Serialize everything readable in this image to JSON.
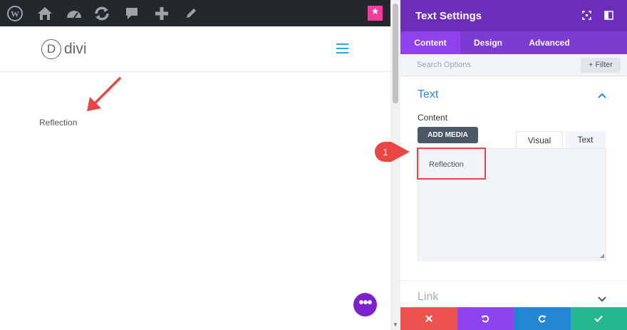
{
  "site": {
    "logo_letter": "D",
    "logo_text": "divi",
    "module_text": "Reflection"
  },
  "panel": {
    "title": "Text Settings",
    "tabs": [
      {
        "label": "Content",
        "active": true
      },
      {
        "label": "Design",
        "active": false
      },
      {
        "label": "Advanced",
        "active": false
      }
    ],
    "search_placeholder": "Search Options",
    "filter_label": "+ Filter",
    "section_title": "Text",
    "content_label": "Content",
    "add_media_label": "ADD MEDIA",
    "editor_tabs": {
      "visual": "Visual",
      "text": "Text"
    },
    "editor_value": "Reflection",
    "link_section_title": "Link"
  },
  "annotation": {
    "badge_number": "1"
  },
  "colors": {
    "admin_bar": "#23282d",
    "panel_header": "#6c2eb9",
    "tabs_bg": "#7e3bd0",
    "accent_blue": "#2b87da",
    "cancel": "#ef5350",
    "undo": "#8e44ec",
    "redo": "#2286d2",
    "save": "#25b58f",
    "highlight": "#e94545"
  }
}
